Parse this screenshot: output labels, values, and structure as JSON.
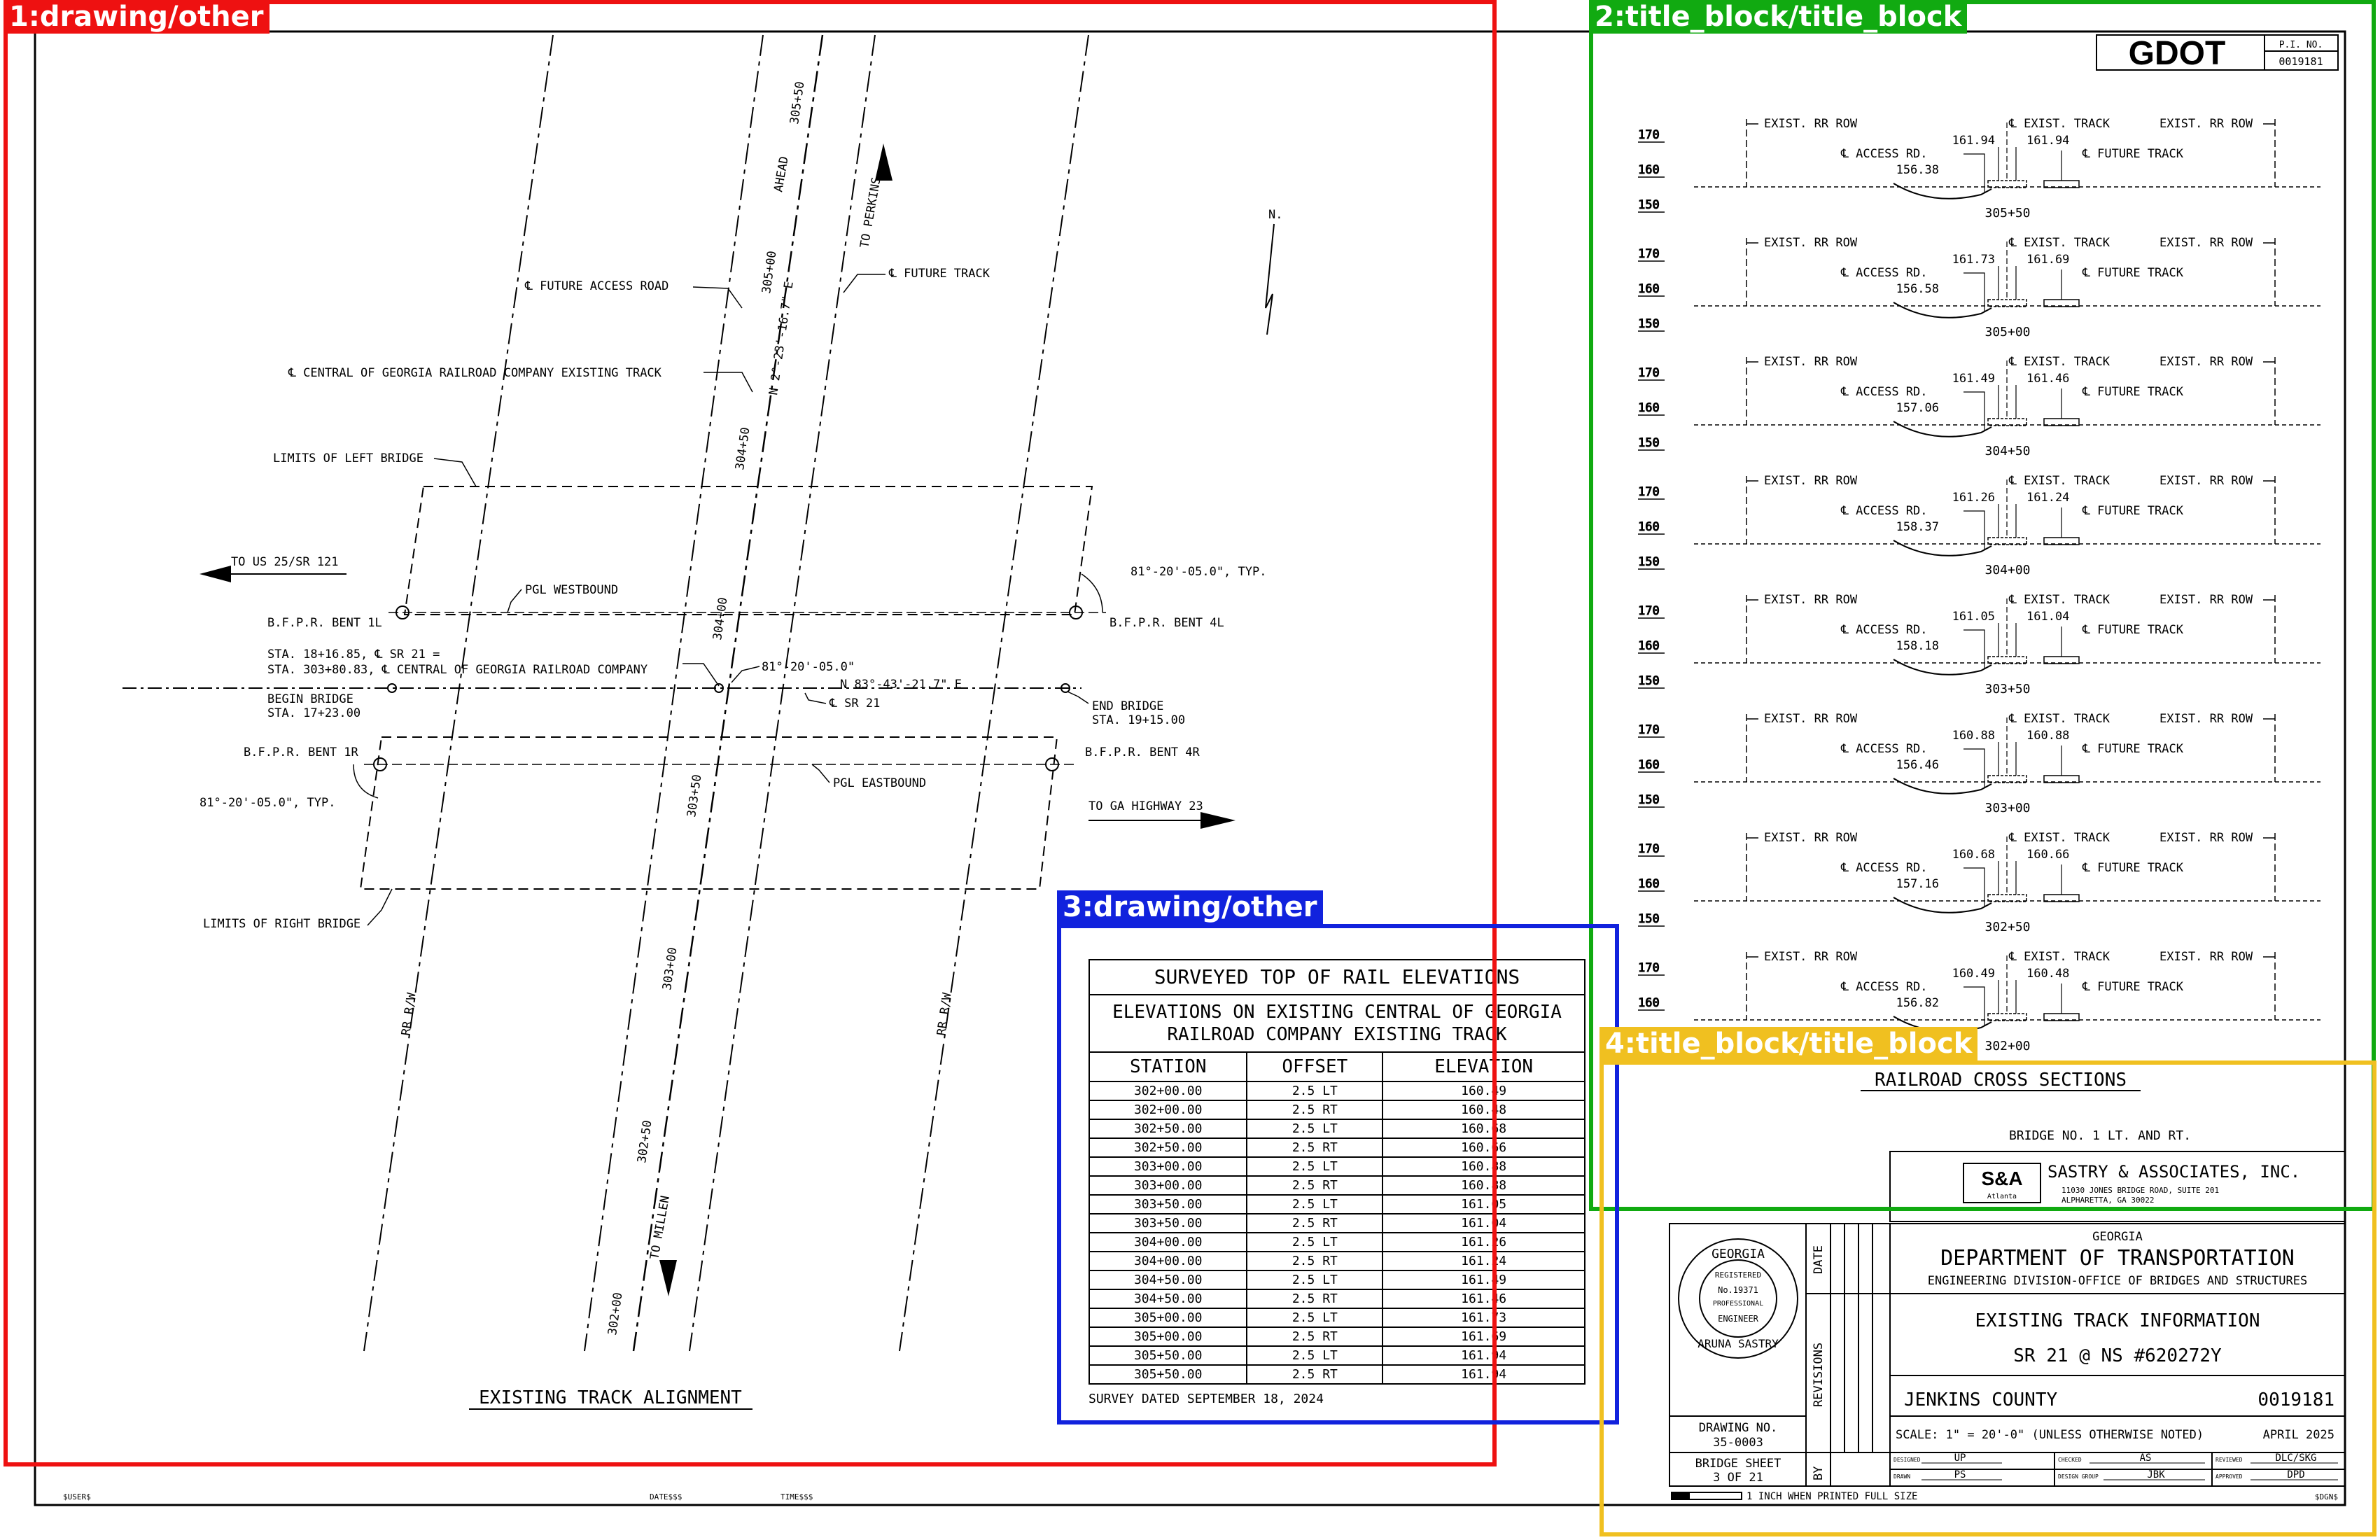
{
  "annotations": [
    {
      "label": "1:drawing/other",
      "color": "#ee1111"
    },
    {
      "label": "2:title_block/title_block",
      "color": "#11aa11"
    },
    {
      "label": "3:drawing/other",
      "color": "#1122dd"
    },
    {
      "label": "4:title_block/title_block",
      "color": "#f0c020"
    }
  ],
  "plan": {
    "title": "EXISTING TRACK ALIGNMENT",
    "labels": {
      "future_access_road": "℄ FUTURE ACCESS ROAD",
      "future_track": "℄ FUTURE TRACK",
      "central_existing": "℄ CENTRAL OF GEORGIA RAILROAD COMPANY EXISTING TRACK",
      "limits_left": "LIMITS OF LEFT BRIDGE",
      "limits_right": "LIMITS OF RIGHT BRIDGE",
      "to_us25": "TO US 25/SR 121",
      "to_ga23": "TO GA HIGHWAY 23",
      "to_perkins": "TO PERKINS",
      "to_millen": "TO MILLEN",
      "ahead": "AHEAD",
      "north": "N.",
      "pgl_west": "PGL WESTBOUND",
      "pgl_east": "PGL EASTBOUND",
      "bent_1l": "B.F.P.R. BENT 1L",
      "bent_4l": "B.F.P.R. BENT 4L",
      "bent_1r": "B.F.P.R. BENT 1R",
      "bent_4r": "B.F.P.R. BENT 4R",
      "sta_line1": "STA. 18+16.85, ℄ SR 21 =",
      "sta_line2": "STA. 303+80.83, ℄ CENTRAL OF GEORGIA RAILROAD COMPANY",
      "begin_bridge": "BEGIN BRIDGE",
      "begin_sta": "STA. 17+23.00",
      "end_bridge": "END BRIDGE",
      "end_sta": "STA. 19+15.00",
      "angle_typ_r": "81°-20'-05.0\", TYP.",
      "angle_typ_l": "81°-20'-05.0\", TYP.",
      "angle_center": "81°-20'-05.0\"",
      "bearing_sr21": "N 83°-43'-21.7\" E",
      "cl_sr21": "℄ SR 21",
      "bearing_rr": "N 2°-23'-16.7\" E",
      "rr_row": "RR R/W",
      "stations": [
        "305+50",
        "305+00",
        "304+50",
        "304+00",
        "303+50",
        "303+00",
        "302+50",
        "302+00"
      ]
    }
  },
  "xsections": {
    "title": "RAILROAD CROSS SECTIONS",
    "elev_labels": [
      "170",
      "160",
      "150"
    ],
    "labels": {
      "exist_rr_row": "EXIST. RR ROW",
      "exist_track": "℄ EXIST. TRACK",
      "access_rd": "℄ ACCESS RD.",
      "future_track": "℄ FUTURE TRACK"
    },
    "sections": [
      {
        "station": "305+50",
        "left": "161.94",
        "right": "161.94",
        "road": "156.38"
      },
      {
        "station": "305+00",
        "left": "161.73",
        "right": "161.69",
        "road": "156.58"
      },
      {
        "station": "304+50",
        "left": "161.49",
        "right": "161.46",
        "road": "157.06"
      },
      {
        "station": "304+00",
        "left": "161.26",
        "right": "161.24",
        "road": "158.37"
      },
      {
        "station": "303+50",
        "left": "161.05",
        "right": "161.04",
        "road": "158.18"
      },
      {
        "station": "303+00",
        "left": "160.88",
        "right": "160.88",
        "road": "156.46"
      },
      {
        "station": "302+50",
        "left": "160.68",
        "right": "160.66",
        "road": "157.16"
      },
      {
        "station": "302+00",
        "left": "160.49",
        "right": "160.48",
        "road": "156.82"
      }
    ]
  },
  "elevations_table": {
    "title": "SURVEYED TOP OF RAIL ELEVATIONS",
    "subtitle_1": "ELEVATIONS ON EXISTING CENTRAL OF GEORGIA",
    "subtitle_2": "RAILROAD COMPANY EXISTING TRACK",
    "headers": [
      "STATION",
      "OFFSET",
      "ELEVATION"
    ],
    "rows": [
      [
        "302+00.00",
        "2.5 LT",
        "160.49"
      ],
      [
        "302+00.00",
        "2.5 RT",
        "160.48"
      ],
      [
        "302+50.00",
        "2.5 LT",
        "160.68"
      ],
      [
        "302+50.00",
        "2.5 RT",
        "160.66"
      ],
      [
        "303+00.00",
        "2.5 LT",
        "160.88"
      ],
      [
        "303+00.00",
        "2.5 RT",
        "160.88"
      ],
      [
        "303+50.00",
        "2.5 LT",
        "161.05"
      ],
      [
        "303+50.00",
        "2.5 RT",
        "161.04"
      ],
      [
        "304+00.00",
        "2.5 LT",
        "161.26"
      ],
      [
        "304+00.00",
        "2.5 RT",
        "161.24"
      ],
      [
        "304+50.00",
        "2.5 LT",
        "161.49"
      ],
      [
        "304+50.00",
        "2.5 RT",
        "161.46"
      ],
      [
        "305+00.00",
        "2.5 LT",
        "161.73"
      ],
      [
        "305+00.00",
        "2.5 RT",
        "161.69"
      ],
      [
        "305+50.00",
        "2.5 LT",
        "161.94"
      ],
      [
        "305+50.00",
        "2.5 RT",
        "161.94"
      ]
    ],
    "note": "SURVEY DATED SEPTEMBER 18, 2024"
  },
  "title_block": {
    "gdot_logo": "GDOT",
    "pi_no_label": "P.I. NO.",
    "pi_no": "0019181",
    "bridge_no": "BRIDGE NO. 1 LT. AND RT.",
    "firm_logo": "S&A",
    "firm_logo_sub": "Atlanta",
    "firm_name": "SASTRY & ASSOCIATES, INC.",
    "firm_addr1": "11030 JONES BRIDGE ROAD, SUITE 201",
    "firm_addr2": "ALPHARETTA, GA 30022",
    "state": "GEORGIA",
    "dept": "DEPARTMENT OF TRANSPORTATION",
    "division": "ENGINEERING DIVISION-OFFICE OF BRIDGES AND STRUCTURES",
    "sheet_title": "EXISTING TRACK INFORMATION",
    "project": "SR 21 @ NS #620272Y",
    "county": "JENKINS COUNTY",
    "project_no": "0019181",
    "scale": "SCALE: 1\" = 20'-0\" (UNLESS OTHERWISE NOTED)",
    "date": "APRIL 2025",
    "drawing_no_label": "DRAWING NO.",
    "drawing_no": "35-0003",
    "bridge_sheet_label": "BRIDGE SHEET",
    "bridge_sheet": "3 OF 21",
    "rev_date": "DATE",
    "revisions": "REVISIONS",
    "by": "BY",
    "designed_label": "DESIGNED",
    "designed": "UP",
    "drawn_label": "DRAWN",
    "drawn": "PS",
    "checked_label": "CHECKED",
    "checked": "AS",
    "design_group_label": "DESIGN GROUP",
    "design_group": "JBK",
    "reviewed_label": "REVIEWED",
    "reviewed": "DLC/SKG",
    "approved_label": "APPROVED",
    "approved": "DPD",
    "seal_top": "GEORGIA",
    "seal_mid1": "REGISTERED",
    "seal_no": "No.19371",
    "seal_mid2": "PROFESSIONAL",
    "seal_eng": "ENGINEER",
    "seal_name": "ARUNA  SASTRY",
    "scale_bar_note": "1 INCH WHEN PRINTED FULL SIZE",
    "footer_user": "$USER$",
    "footer_date": "DATE$$$",
    "footer_time": "TIME$$$",
    "footer_dgn": "$DGN$"
  }
}
